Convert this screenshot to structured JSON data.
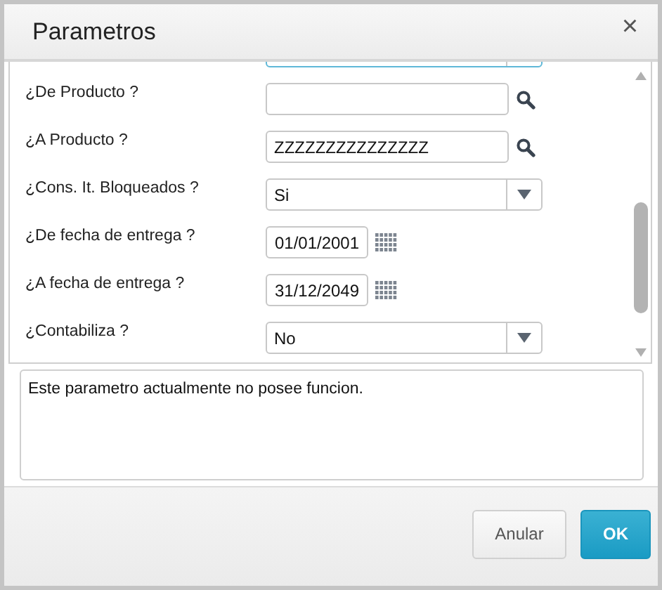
{
  "window": {
    "title": "Parametros",
    "close": "×"
  },
  "fields": [
    {
      "kind": "select",
      "focused": true
    },
    {
      "kind": "search",
      "label": "¿De Producto ?",
      "focused": false
    },
    {
      "kind": "search",
      "label": "¿A Producto ?",
      "value": "ZZZZZZZZZZZZZZZ",
      "focused": false
    },
    {
      "kind": "select",
      "label": "¿Cons. It. Bloqueados ?",
      "value": "Si",
      "focused": false
    },
    {
      "kind": "date",
      "label": "¿De fecha de entrega ?",
      "value": "01/01/2001",
      "focused": false
    },
    {
      "kind": "date",
      "label": "¿A fecha de entrega ?",
      "value": "31/12/2049",
      "focused": false
    },
    {
      "kind": "select",
      "label": "¿Contabiliza ?",
      "value": "No",
      "focused": false
    }
  ],
  "help_text": "Este parametro actualmente no posee funcion.",
  "buttons": [
    {
      "label": "Anular",
      "kind": "secondary"
    },
    {
      "label": "OK",
      "kind": "primary"
    }
  ]
}
